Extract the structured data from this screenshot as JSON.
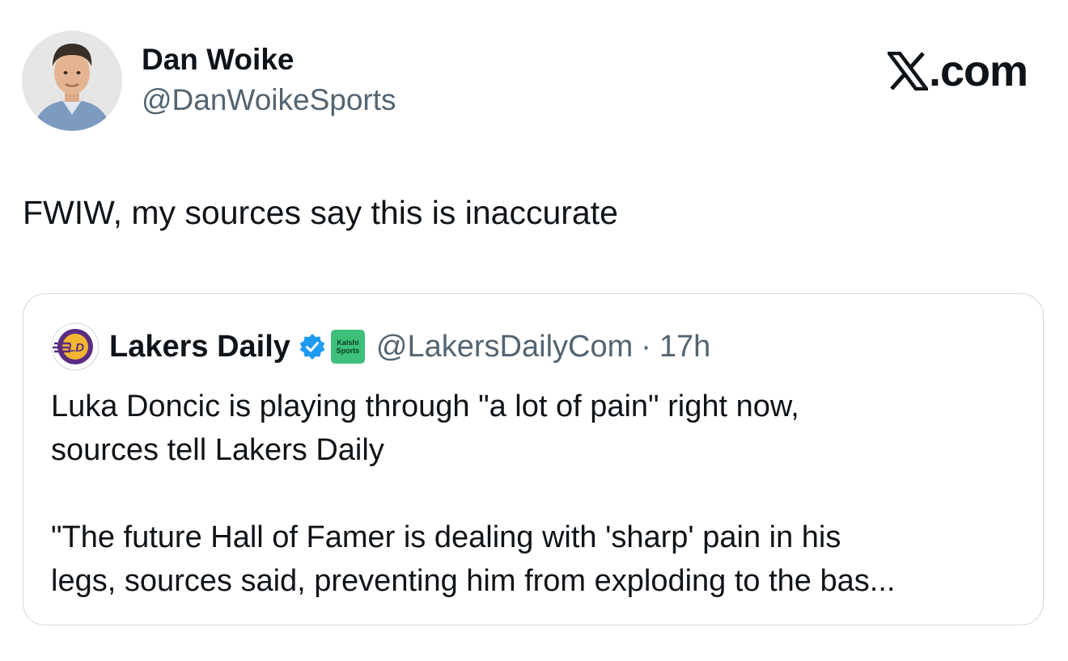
{
  "tweet": {
    "author": {
      "name": "Dan Woike",
      "handle": "@DanWoikeSports",
      "avatar": "author-avatar-photo"
    },
    "brand": {
      "text": ".com",
      "icon": "x-logo-icon"
    },
    "text": "FWIW, my sources say this is inaccurate"
  },
  "quote": {
    "account": {
      "name": "Lakers Daily",
      "logo": "lakers-daily-logo",
      "verified_icon": "verified-badge-icon",
      "badge_line1": "Kalshi",
      "badge_line2": "Sports",
      "handle": "@LakersDailyCom",
      "separator": "·",
      "time": "17h"
    },
    "text_lines": [
      "Luka Doncic is playing through \"a lot of pain\" right now,",
      "sources tell Lakers Daily",
      "\"The future Hall of Famer is dealing with 'sharp' pain in his",
      "legs, sources said, preventing him from exploding to the bas..."
    ]
  },
  "colors": {
    "text_primary": "#0f1419",
    "text_secondary": "#536471",
    "card_border": "#cfd9de",
    "verified_blue": "#1d9bf0",
    "badge_green": "#3ec07a",
    "lakers_purple": "#5a2d82",
    "lakers_gold": "#f2b631"
  }
}
